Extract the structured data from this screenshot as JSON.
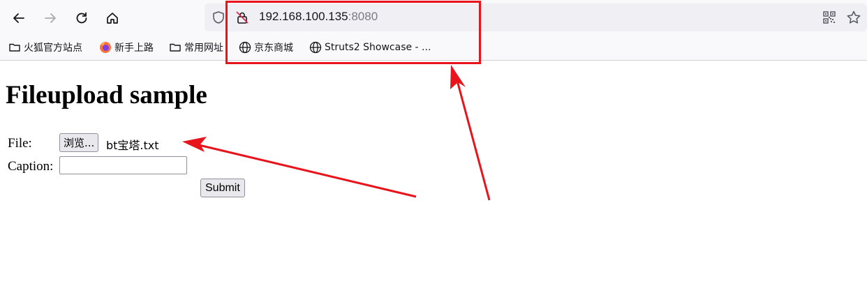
{
  "browser": {
    "nav": {
      "back_icon": "arrow-left-icon",
      "forward_icon": "arrow-right-icon",
      "reload_icon": "reload-icon",
      "home_icon": "home-icon"
    },
    "url": {
      "host": "192.168.100.135",
      "port": ":8080"
    },
    "bookmarks": [
      {
        "label": "火狐官方站点",
        "icon": "folder-icon"
      },
      {
        "label": "新手上路",
        "icon": "firefox-icon"
      },
      {
        "label": "常用网址",
        "icon": "folder-icon"
      },
      {
        "label": "京东商城",
        "icon": "globe-icon"
      },
      {
        "label": "Struts2 Showcase - ...",
        "icon": "globe-icon"
      }
    ]
  },
  "page": {
    "title": "Fileupload sample",
    "form": {
      "file_label": "File:",
      "browse_label": "浏览...",
      "file_name": "bt宝塔.txt",
      "caption_label": "Caption:",
      "caption_value": "",
      "submit_label": "Submit"
    }
  },
  "colors": {
    "annotation": "#e8131b",
    "chrome_bg": "#f9f9fb",
    "url_bar_bg": "#f0f0f4"
  }
}
